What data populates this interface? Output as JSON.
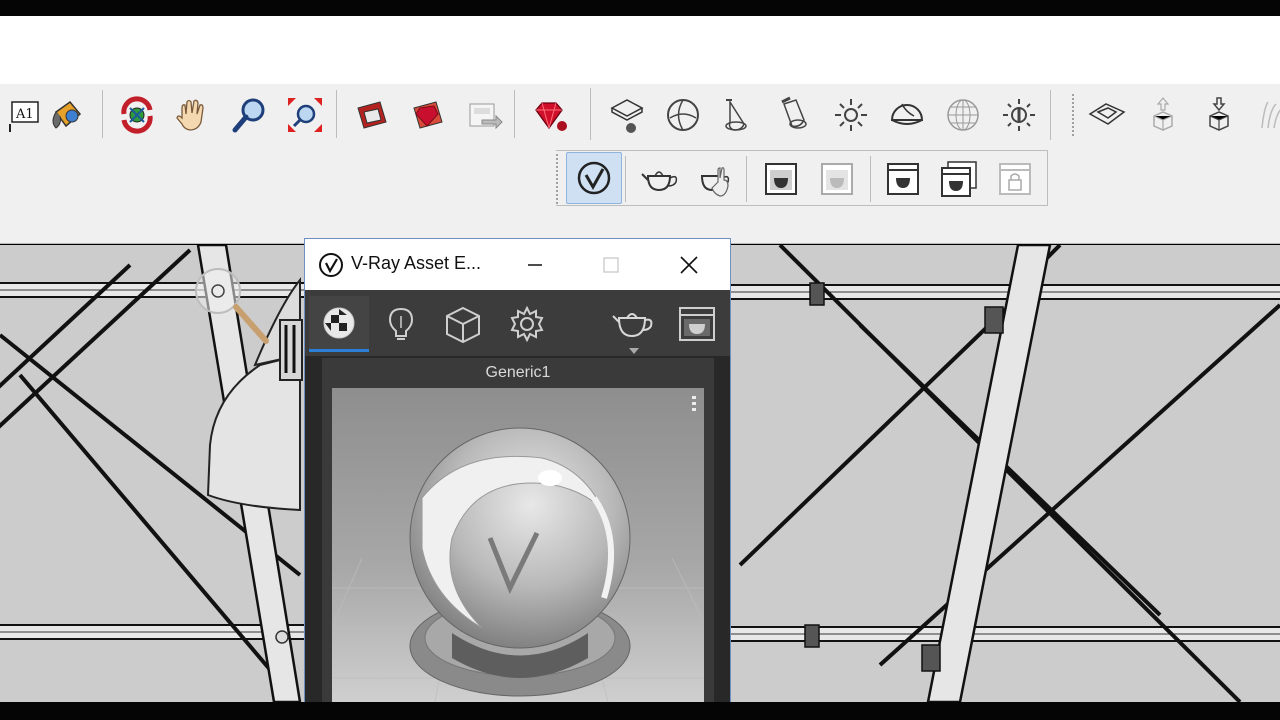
{
  "window": {
    "title": "V-Ray Asset E...",
    "minimize_glyph": "—",
    "restore_glyph": "☐",
    "close_glyph": "✕"
  },
  "toolbar": {
    "text_tool_label": "A1",
    "icons": [
      "text-tool-icon",
      "paint-bucket-icon",
      "orbit-icon",
      "pan-icon",
      "zoom-icon",
      "zoom-extents-icon",
      "3d-warehouse-icon",
      "extension-warehouse-icon",
      "layout-icon",
      "ruby-console-icon",
      "vray-dome-light-icon",
      "vray-sphere-light-icon",
      "vray-spot-light-icon",
      "vray-ies-light-icon",
      "vray-omni-light-icon",
      "vray-mesh-light-icon",
      "vray-infinite-plane-icon",
      "vray-sun-icon",
      "vray-proxy-icon",
      "export-proxy-icon",
      "import-proxy-icon",
      "vray-asset-editor-icon",
      "render-icon",
      "render-interactive-icon",
      "frame-buffer-icon",
      "render-region-icon",
      "batch-render-icon",
      "cloud-render-icon",
      "lock-camera-icon"
    ]
  },
  "asset_editor": {
    "tabs": [
      "materials-tab",
      "lights-tab",
      "geometry-tab",
      "settings-tab"
    ],
    "material_name": "Generic1"
  },
  "colors": {
    "accent": "#2b7fd6",
    "ruby": "#c8102e",
    "panel_dark": "#2f2f2f"
  }
}
